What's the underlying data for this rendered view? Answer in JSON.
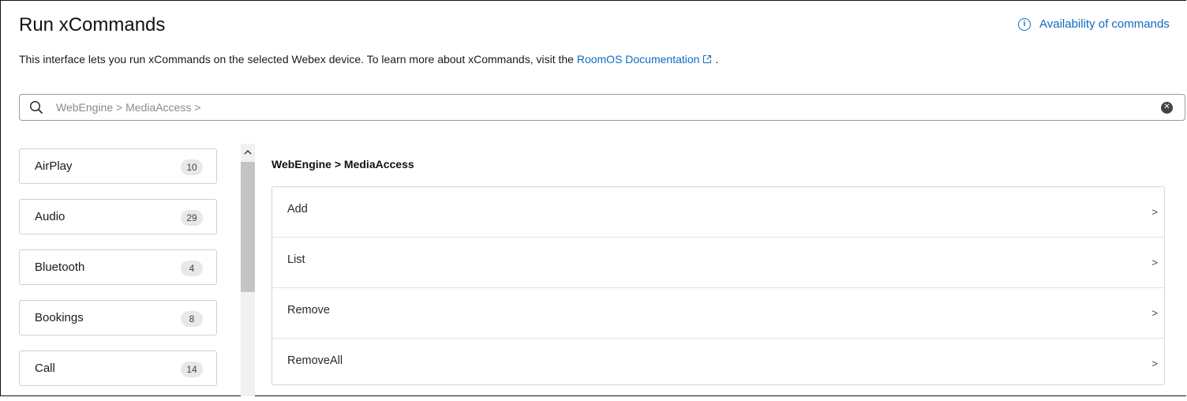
{
  "header": {
    "title": "Run xCommands",
    "availability_link": "Availability of commands"
  },
  "intro": {
    "text": "This interface lets you run xCommands on the selected Webex device. To learn more about xCommands, visit the ",
    "link": "RoomOS Documentation",
    "suffix": "."
  },
  "search": {
    "placeholder": "WebEngine > MediaAccess >"
  },
  "categories": [
    {
      "name": "AirPlay",
      "count": "10"
    },
    {
      "name": "Audio",
      "count": "29"
    },
    {
      "name": "Bluetooth",
      "count": "4"
    },
    {
      "name": "Bookings",
      "count": "8"
    },
    {
      "name": "Call",
      "count": "14"
    }
  ],
  "main": {
    "breadcrumb": "WebEngine > MediaAccess",
    "commands": [
      {
        "label": "Add",
        "chevron": ">"
      },
      {
        "label": "List",
        "chevron": ">"
      },
      {
        "label": "Remove",
        "chevron": ">"
      },
      {
        "label": "RemoveAll",
        "chevron": ">"
      }
    ]
  },
  "colors": {
    "accent_link": "#0d6bc2",
    "border": "#d0d0d0",
    "badge_bg": "#e8e8e8"
  }
}
